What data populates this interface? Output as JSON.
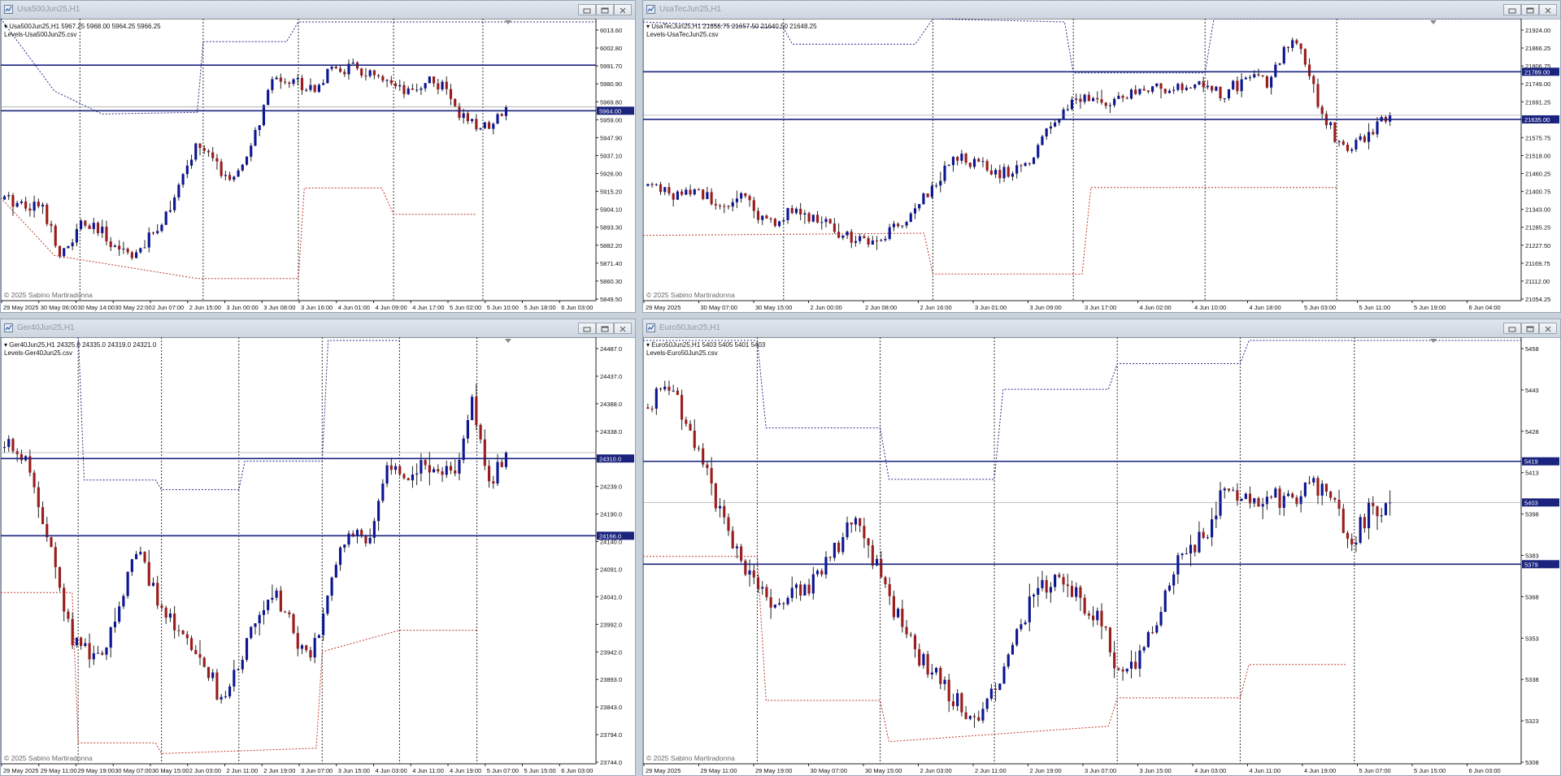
{
  "colors": {
    "bull": "#0c1593",
    "bear": "#9b1c1c",
    "level_line": "#1a237e",
    "upper_band": "#2a2a8a",
    "lower_band": "#c0392b",
    "grid": "#333333",
    "price_tag_bg": "#1a237e",
    "title_text": "#8f9aa7"
  },
  "icons": {
    "window": "chart-window-icon",
    "minimize": "minimize-icon",
    "restore": "restore-icon",
    "close": "close-icon"
  },
  "charts": [
    {
      "id": "usa500",
      "title": "Usa500Jun25,H1",
      "ohlc": "Usa500Jun25,H1  5967.25 5968.00 5964.25 5966.25",
      "levels_file": "Levels-Usa500Jun25.csv",
      "copyright": "© 2025 Sabino Martiradonna",
      "y_ticks": [
        "6013.60",
        "6002.80",
        "5991.70",
        "5980.90",
        "5969.80",
        "5959.00",
        "5947.90",
        "5937.10",
        "5926.00",
        "5915.20",
        "5904.10",
        "5893.30",
        "5882.20",
        "5871.40",
        "5860.30",
        "5849.50"
      ],
      "y_range": [
        5849.5,
        6018
      ],
      "x_ticks": [
        "29 May 2025",
        "30 May 06:00",
        "30 May 14:00",
        "30 May 22:00",
        "2 Jun 07:00",
        "2 Jun 15:00",
        "3 Jun 00:00",
        "3 Jun 08:00",
        "3 Jun 16:00",
        "4 Jun 01:00",
        "4 Jun 09:00",
        "4 Jun 17:00",
        "5 Jun 02:00",
        "5 Jun 10:00",
        "5 Jun 18:00",
        "6 Jun 03:00"
      ],
      "levels": [
        5991.7,
        5964.0
      ],
      "price_tags": [
        "5964.00"
      ],
      "current_price": 5966.25,
      "anchors": [
        5910,
        5908,
        5905,
        5875,
        5895,
        5890,
        5880,
        5877,
        5895,
        5915,
        5945,
        5930,
        5920,
        5950,
        5985,
        5982,
        5978,
        5988,
        5990,
        5985,
        5978,
        5973,
        5984,
        5975,
        5955,
        5955,
        5966
      ],
      "upper_band": [
        [
          0,
          6020
        ],
        [
          0.09,
          5976
        ],
        [
          0.17,
          5962
        ],
        [
          0.33,
          5963
        ],
        [
          0.34,
          6006
        ],
        [
          0.48,
          6006
        ],
        [
          0.5,
          6018
        ],
        [
          1,
          6018
        ]
      ],
      "lower_band": [
        [
          0,
          5911
        ],
        [
          0.09,
          5876
        ],
        [
          0.33,
          5862
        ],
        [
          0.5,
          5862
        ],
        [
          0.51,
          5917
        ],
        [
          0.64,
          5917
        ],
        [
          0.66,
          5901
        ],
        [
          0.8,
          5901
        ]
      ],
      "vlines": [
        0.133,
        0.34,
        0.5,
        0.66,
        0.81
      ]
    },
    {
      "id": "usatec",
      "title": "UsaTecJun25,H1",
      "ohlc": "UsaTecJun25,H1  21656.75 21657.50 21640.50 21648.25",
      "levels_file": "Levels-UsaTecJun25.csv",
      "copyright": "© 2025 Sabino Martiradonna",
      "y_ticks": [
        "21924.00",
        "21866.25",
        "21806.75",
        "21749.00",
        "21691.25",
        "21633.50",
        "21575.75",
        "21518.00",
        "21460.25",
        "21400.75",
        "21343.00",
        "21285.25",
        "21227.50",
        "21169.75",
        "21112.00",
        "21054.25"
      ],
      "y_range": [
        21054.25,
        21950
      ],
      "x_ticks": [
        "29 May 2025",
        "30 May 07:00",
        "30 May 15:00",
        "2 Jun 00:00",
        "2 Jun 08:00",
        "2 Jun 16:00",
        "3 Jun 01:00",
        "3 Jun 09:00",
        "3 Jun 17:00",
        "4 Jun 02:00",
        "4 Jun 10:00",
        "4 Jun 18:00",
        "5 Jun 03:00",
        "5 Jun 11:00",
        "5 Jun 19:00",
        "6 Jun 04:00"
      ],
      "levels": [
        21789.0,
        21635.0
      ],
      "price_tags": [
        "21789.00",
        "21635.00"
      ],
      "current_price": 21648.25,
      "anchors": [
        21420,
        21390,
        21400,
        21370,
        21380,
        21290,
        21340,
        21310,
        21270,
        21240,
        21260,
        21320,
        21430,
        21520,
        21480,
        21460,
        21500,
        21640,
        21700,
        21690,
        21705,
        21735,
        21725,
        21745,
        21720,
        21760,
        21760,
        21920,
        21690,
        21530,
        21575,
        21655
      ],
      "upper_band": [
        [
          0,
          21950
        ],
        [
          0.16,
          21930
        ],
        [
          0.17,
          21878
        ],
        [
          0.31,
          21878
        ],
        [
          0.33,
          21960
        ],
        [
          0.48,
          21950
        ],
        [
          0.49,
          21785
        ],
        [
          0.64,
          21785
        ],
        [
          0.65,
          21960
        ],
        [
          1,
          21960
        ]
      ],
      "lower_band": [
        [
          0,
          21260
        ],
        [
          0.32,
          21267
        ],
        [
          0.33,
          21135
        ],
        [
          0.5,
          21135
        ],
        [
          0.51,
          21415
        ],
        [
          0.64,
          21415
        ],
        [
          0.65,
          21415
        ],
        [
          0.79,
          21415
        ]
      ],
      "vlines": [
        0.16,
        0.33,
        0.49,
        0.64,
        0.79
      ]
    },
    {
      "id": "ger40",
      "title": "Ger40Jun25,H1",
      "ohlc": "Ger40Jun25,H1  24325.0 24335.0 24319.0 24321.0",
      "levels_file": "Levels-Ger40Jun25.csv",
      "copyright": "© 2025 Sabino Martiradonna",
      "y_ticks": [
        "24487.0",
        "24437.0",
        "24388.0",
        "24338.0",
        "24289.0",
        "24239.0",
        "24190.0",
        "24140.0",
        "24091.0",
        "24041.0",
        "23992.0",
        "23942.0",
        "23893.0",
        "23843.0",
        "23794.0",
        "23744.0"
      ],
      "y_range": [
        23744,
        24530
      ],
      "x_ticks": [
        "29 May 2025",
        "29 May 11:00",
        "29 May 19:00",
        "30 May 07:00",
        "30 May 15:00",
        "2 Jun 03:00",
        "2 Jun 11:00",
        "2 Jun 19:00",
        "3 Jun 07:00",
        "3 Jun 15:00",
        "4 Jun 03:00",
        "4 Jun 11:00",
        "4 Jun 19:00",
        "5 Jun 07:00",
        "5 Jun 15:00",
        "6 Jun 03:00"
      ],
      "levels": [
        24310.0,
        24166.0
      ],
      "price_tags": [
        "24310.0",
        "24166.0"
      ],
      "current_price": 24321.0,
      "anchors": [
        24330,
        24320,
        24240,
        24120,
        23980,
        23940,
        23960,
        24050,
        24150,
        24060,
        24010,
        23980,
        23930,
        23850,
        23920,
        24020,
        24060,
        24010,
        23930,
        24000,
        24140,
        24160,
        24160,
        24300,
        24260,
        24300,
        24290,
        24300,
        24420,
        24270,
        24300
      ],
      "upper_band": [
        [
          0,
          24545
        ],
        [
          0.13,
          24545
        ],
        [
          0.14,
          24270
        ],
        [
          0.26,
          24270
        ],
        [
          0.27,
          24252
        ],
        [
          0.4,
          24252
        ],
        [
          0.41,
          24305
        ],
        [
          0.54,
          24305
        ],
        [
          0.55,
          24530
        ],
        [
          0.67,
          24530
        ]
      ],
      "lower_band": [
        [
          0,
          24060
        ],
        [
          0.12,
          24060
        ],
        [
          0.13,
          23780
        ],
        [
          0.26,
          23780
        ],
        [
          0.27,
          23760
        ],
        [
          0.53,
          23770
        ],
        [
          0.54,
          23950
        ],
        [
          0.67,
          23990
        ],
        [
          0.8,
          23990
        ]
      ],
      "vlines": [
        0.13,
        0.27,
        0.4,
        0.54,
        0.67,
        0.8
      ]
    },
    {
      "id": "euro50",
      "title": "Euro50Jun25,H1",
      "ohlc": "Euro50Jun25,H1  5403 5405 5401 5403",
      "levels_file": "Levels-Euro50Jun25.csv",
      "copyright": "© 2025 Sabino Martiradonna",
      "y_ticks": [
        "5458",
        "5443",
        "5428",
        "5413",
        "5398",
        "5383",
        "5368",
        "5353",
        "5338",
        "5323",
        "5308"
      ],
      "y_range": [
        5302,
        5466
      ],
      "x_ticks": [
        "29 May 2025",
        "29 May 11:00",
        "29 May 19:00",
        "30 May 07:00",
        "30 May 15:00",
        "2 Jun 03:00",
        "2 Jun 11:00",
        "2 Jun 19:00",
        "3 Jun 07:00",
        "3 Jun 15:00",
        "4 Jun 03:00",
        "4 Jun 11:00",
        "4 Jun 19:00",
        "5 Jun 07:00",
        "5 Jun 15:00",
        "6 Jun 03:00"
      ],
      "levels": [
        5419,
        5379
      ],
      "price_tags": [
        "5419",
        "5403",
        "5379"
      ],
      "current_price": 5403,
      "anchors": [
        5440,
        5450,
        5430,
        5410,
        5390,
        5375,
        5365,
        5368,
        5372,
        5385,
        5395,
        5380,
        5360,
        5345,
        5335,
        5325,
        5320,
        5335,
        5355,
        5370,
        5375,
        5365,
        5355,
        5335,
        5345,
        5365,
        5385,
        5390,
        5410,
        5405,
        5405,
        5405,
        5408,
        5410,
        5385,
        5400,
        5402
      ],
      "upper_band": [
        [
          0,
          5466
        ],
        [
          0.13,
          5466
        ],
        [
          0.14,
          5432
        ],
        [
          0.27,
          5432
        ],
        [
          0.28,
          5412
        ],
        [
          0.4,
          5412
        ],
        [
          0.41,
          5447
        ],
        [
          0.53,
          5447
        ],
        [
          0.54,
          5457
        ],
        [
          0.68,
          5457
        ],
        [
          0.69,
          5466
        ],
        [
          1,
          5466
        ]
      ],
      "lower_band": [
        [
          0,
          5382
        ],
        [
          0.13,
          5382
        ],
        [
          0.14,
          5326
        ],
        [
          0.27,
          5326
        ],
        [
          0.28,
          5310
        ],
        [
          0.53,
          5316
        ],
        [
          0.54,
          5327
        ],
        [
          0.68,
          5327
        ],
        [
          0.69,
          5340
        ],
        [
          0.8,
          5340
        ]
      ],
      "vlines": [
        0.13,
        0.27,
        0.4,
        0.54,
        0.68,
        0.81
      ]
    }
  ]
}
